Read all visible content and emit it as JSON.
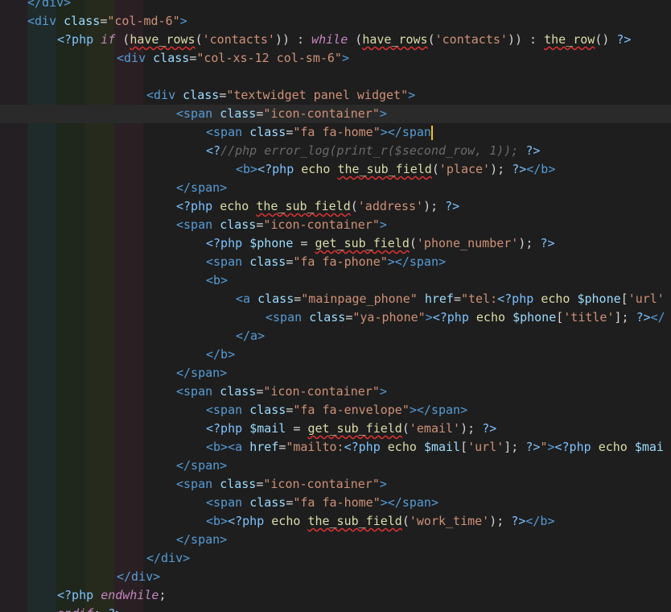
{
  "colors": {
    "background": "#1e1e1e",
    "current_line": "#2a2a2a",
    "tag": "#569cd6",
    "attribute": "#9cdcfe",
    "string": "#ce9178",
    "php_keyword": "#c586c0",
    "function": "#dcdcaa",
    "comment": "#6a6a6a",
    "cursor": "#f1c40f",
    "error_squiggle": "#d33"
  },
  "editor": {
    "cursor_line": 6,
    "lines": [
      {
        "indent": 0,
        "tokens": [
          [
            "tag",
            "</div>"
          ]
        ]
      },
      {
        "indent": 0,
        "tokens": [
          [
            "tag",
            "<div "
          ],
          [
            "attr",
            "class"
          ],
          [
            "pun",
            "="
          ],
          [
            "str",
            "\"col-md-6\""
          ],
          [
            "tag",
            ">"
          ]
        ]
      },
      {
        "indent": 1,
        "tokens": [
          [
            "php",
            "<?php "
          ],
          [
            "kw",
            "if "
          ],
          [
            "pun",
            "("
          ],
          [
            "fnsq",
            "have_rows"
          ],
          [
            "pun",
            "("
          ],
          [
            "str",
            "'contacts'"
          ],
          [
            "pun",
            ")) : "
          ],
          [
            "kw",
            "while "
          ],
          [
            "pun",
            "("
          ],
          [
            "fnsq",
            "have_rows"
          ],
          [
            "pun",
            "("
          ],
          [
            "str",
            "'contacts'"
          ],
          [
            "pun",
            ")) : "
          ],
          [
            "fnsq",
            "the_row"
          ],
          [
            "pun",
            "() "
          ],
          [
            "php",
            "?>"
          ]
        ]
      },
      {
        "indent": 3,
        "tokens": [
          [
            "tag",
            "<div "
          ],
          [
            "attr",
            "class"
          ],
          [
            "pun",
            "="
          ],
          [
            "str",
            "\"col-xs-12 col-sm-6\""
          ],
          [
            "tag",
            ">"
          ]
        ]
      },
      {
        "indent": 0,
        "tokens": []
      },
      {
        "indent": 4,
        "tokens": [
          [
            "tag",
            "<div "
          ],
          [
            "attr",
            "class"
          ],
          [
            "pun",
            "="
          ],
          [
            "str",
            "\"textwidget panel widget\""
          ],
          [
            "tag",
            ">"
          ]
        ]
      },
      {
        "indent": 5,
        "tokens": [
          [
            "tag",
            "<span "
          ],
          [
            "attr",
            "class"
          ],
          [
            "pun",
            "="
          ],
          [
            "str",
            "\"icon-container\""
          ],
          [
            "tag",
            ">"
          ]
        ]
      },
      {
        "indent": 6,
        "tokens": [
          [
            "tag",
            "<span "
          ],
          [
            "attr",
            "class"
          ],
          [
            "pun",
            "="
          ],
          [
            "str",
            "\"fa fa-home\""
          ],
          [
            "tag",
            "></span"
          ],
          [
            "cursor",
            ""
          ]
        ]
      },
      {
        "indent": 6,
        "tokens": [
          [
            "php",
            "<?"
          ],
          [
            "com",
            "//php error_log(print_r($second_row, 1)); "
          ],
          [
            "php",
            "?>"
          ]
        ]
      },
      {
        "indent": 7,
        "tokens": [
          [
            "tag",
            "<b>"
          ],
          [
            "php",
            "<?php "
          ],
          [
            "fn",
            "echo "
          ],
          [
            "fnsq",
            "the_sub_field"
          ],
          [
            "pun",
            "("
          ],
          [
            "str",
            "'place'"
          ],
          [
            "pun",
            "); "
          ],
          [
            "php",
            "?>"
          ],
          [
            "tag",
            "</b>"
          ]
        ]
      },
      {
        "indent": 5,
        "tokens": [
          [
            "tag",
            "</span>"
          ]
        ]
      },
      {
        "indent": 5,
        "tokens": [
          [
            "php",
            "<?php "
          ],
          [
            "fn",
            "echo "
          ],
          [
            "fnsq",
            "the_sub_field"
          ],
          [
            "pun",
            "("
          ],
          [
            "str",
            "'address'"
          ],
          [
            "pun",
            "); "
          ],
          [
            "php",
            "?>"
          ]
        ]
      },
      {
        "indent": 5,
        "tokens": [
          [
            "tag",
            "<span "
          ],
          [
            "attr",
            "class"
          ],
          [
            "pun",
            "="
          ],
          [
            "str",
            "\"icon-container\""
          ],
          [
            "tag",
            ">"
          ]
        ]
      },
      {
        "indent": 6,
        "tokens": [
          [
            "php",
            "<?php "
          ],
          [
            "var",
            "$phone"
          ],
          [
            "pun",
            " = "
          ],
          [
            "fnsq",
            "get_sub_field"
          ],
          [
            "pun",
            "("
          ],
          [
            "str",
            "'phone_number'"
          ],
          [
            "pun",
            "); "
          ],
          [
            "php",
            "?>"
          ]
        ]
      },
      {
        "indent": 6,
        "tokens": [
          [
            "tag",
            "<span "
          ],
          [
            "attr",
            "class"
          ],
          [
            "pun",
            "="
          ],
          [
            "str",
            "\"fa fa-phone\""
          ],
          [
            "tag",
            "></span>"
          ]
        ]
      },
      {
        "indent": 6,
        "tokens": [
          [
            "tag",
            "<b>"
          ]
        ]
      },
      {
        "indent": 7,
        "tokens": [
          [
            "tag",
            "<a "
          ],
          [
            "attr",
            "class"
          ],
          [
            "pun",
            "="
          ],
          [
            "str",
            "\"mainpage_phone\" "
          ],
          [
            "attr",
            "href"
          ],
          [
            "pun",
            "="
          ],
          [
            "str",
            "\"tel:"
          ],
          [
            "php",
            "<?php "
          ],
          [
            "fn",
            "echo "
          ],
          [
            "var",
            "$phone"
          ],
          [
            "pun",
            "["
          ],
          [
            "str",
            "'url'"
          ]
        ]
      },
      {
        "indent": 8,
        "tokens": [
          [
            "tag",
            "<span "
          ],
          [
            "attr",
            "class"
          ],
          [
            "pun",
            "="
          ],
          [
            "str",
            "\"ya-phone\""
          ],
          [
            "tag",
            ">"
          ],
          [
            "php",
            "<?php "
          ],
          [
            "fn",
            "echo "
          ],
          [
            "var",
            "$phone"
          ],
          [
            "pun",
            "["
          ],
          [
            "str",
            "'title'"
          ],
          [
            "pun",
            "]; "
          ],
          [
            "php",
            "?>"
          ],
          [
            "tag",
            "</"
          ]
        ]
      },
      {
        "indent": 7,
        "tokens": [
          [
            "tag",
            "</a>"
          ]
        ]
      },
      {
        "indent": 6,
        "tokens": [
          [
            "tag",
            "</b>"
          ]
        ]
      },
      {
        "indent": 5,
        "tokens": [
          [
            "tag",
            "</span>"
          ]
        ]
      },
      {
        "indent": 5,
        "tokens": [
          [
            "tag",
            "<span "
          ],
          [
            "attr",
            "class"
          ],
          [
            "pun",
            "="
          ],
          [
            "str",
            "\"icon-container\""
          ],
          [
            "tag",
            ">"
          ]
        ]
      },
      {
        "indent": 6,
        "tokens": [
          [
            "tag",
            "<span "
          ],
          [
            "attr",
            "class"
          ],
          [
            "pun",
            "="
          ],
          [
            "str",
            "\"fa fa-envelope\""
          ],
          [
            "tag",
            "></span>"
          ]
        ]
      },
      {
        "indent": 6,
        "tokens": [
          [
            "php",
            "<?php "
          ],
          [
            "var",
            "$mail"
          ],
          [
            "pun",
            " = "
          ],
          [
            "fnsq",
            "get_sub_field"
          ],
          [
            "pun",
            "("
          ],
          [
            "str",
            "'email'"
          ],
          [
            "pun",
            "); "
          ],
          [
            "php",
            "?>"
          ]
        ]
      },
      {
        "indent": 6,
        "tokens": [
          [
            "tag",
            "<b><a "
          ],
          [
            "attr",
            "href"
          ],
          [
            "pun",
            "="
          ],
          [
            "str",
            "\"mailto:"
          ],
          [
            "php",
            "<?php "
          ],
          [
            "fn",
            "echo "
          ],
          [
            "var",
            "$mail"
          ],
          [
            "pun",
            "["
          ],
          [
            "str",
            "'url'"
          ],
          [
            "pun",
            "]; "
          ],
          [
            "php",
            "?>"
          ],
          [
            "str",
            "\""
          ],
          [
            "tag",
            ">"
          ],
          [
            "php",
            "<?php "
          ],
          [
            "fn",
            "echo "
          ],
          [
            "var",
            "$mai"
          ]
        ]
      },
      {
        "indent": 5,
        "tokens": [
          [
            "tag",
            "</span>"
          ]
        ]
      },
      {
        "indent": 5,
        "tokens": [
          [
            "tag",
            "<span "
          ],
          [
            "attr",
            "class"
          ],
          [
            "pun",
            "="
          ],
          [
            "str",
            "\"icon-container\""
          ],
          [
            "tag",
            ">"
          ]
        ]
      },
      {
        "indent": 6,
        "tokens": [
          [
            "tag",
            "<span "
          ],
          [
            "attr",
            "class"
          ],
          [
            "pun",
            "="
          ],
          [
            "str",
            "\"fa fa-home\""
          ],
          [
            "tag",
            "></span>"
          ]
        ]
      },
      {
        "indent": 6,
        "tokens": [
          [
            "tag",
            "<b>"
          ],
          [
            "php",
            "<?php "
          ],
          [
            "fn",
            "echo "
          ],
          [
            "fnsq",
            "the_sub_field"
          ],
          [
            "pun",
            "("
          ],
          [
            "str",
            "'work_time'"
          ],
          [
            "pun",
            "); "
          ],
          [
            "php",
            "?>"
          ],
          [
            "tag",
            "</b>"
          ]
        ]
      },
      {
        "indent": 5,
        "tokens": [
          [
            "tag",
            "</span>"
          ]
        ]
      },
      {
        "indent": 4,
        "tokens": [
          [
            "tag",
            "</div>"
          ]
        ]
      },
      {
        "indent": 3,
        "tokens": [
          [
            "tag",
            "</div>"
          ]
        ]
      },
      {
        "indent": 1,
        "tokens": [
          [
            "php",
            "<?php "
          ],
          [
            "kw",
            "endwhile"
          ],
          [
            "pun",
            ";"
          ]
        ]
      },
      {
        "indent": 1,
        "tokens": [
          [
            "kw",
            "endif"
          ],
          [
            "pun",
            "; "
          ],
          [
            "php",
            "?>"
          ]
        ]
      }
    ]
  }
}
